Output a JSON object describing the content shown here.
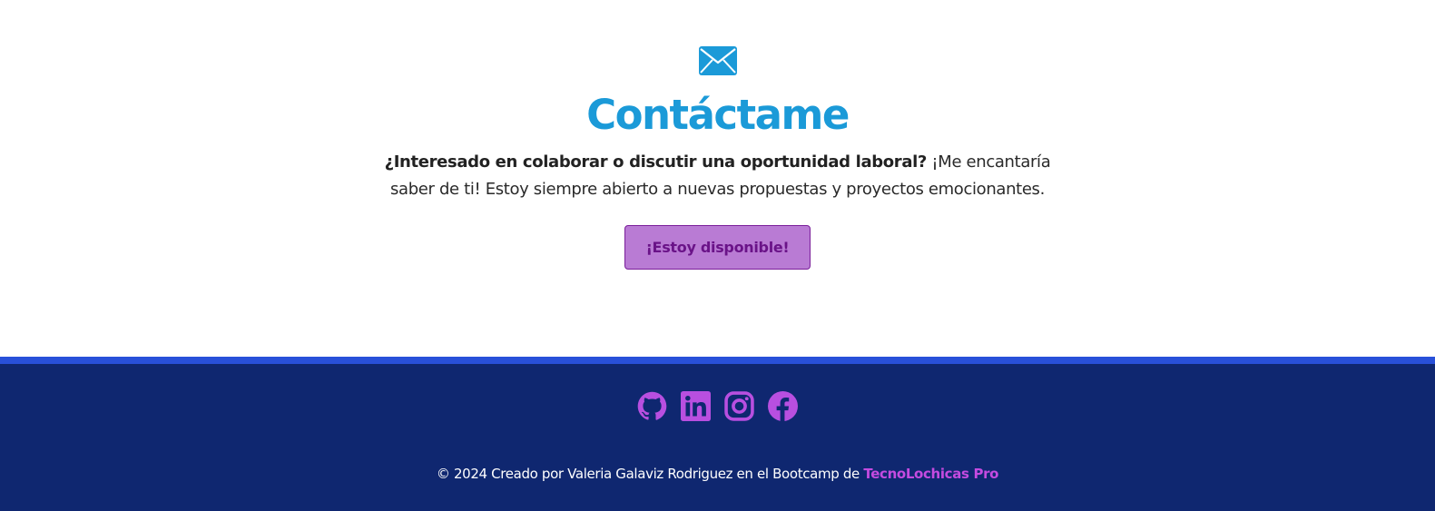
{
  "contact": {
    "icon": "envelope-icon",
    "title": "Contáctame",
    "lead_bold": "¿Interesado en colaborar o discutir una oportunidad laboral?",
    "lead_text": " ¡Me encantaría saber de ti! Estoy siempre abierto a nuevas propuestas y proyectos emocionantes.",
    "button_label": "¡Estoy disponible!"
  },
  "footer": {
    "social_icons": [
      "github-icon",
      "linkedin-icon",
      "instagram-icon",
      "facebook-icon"
    ],
    "copyright_text": "© 2024 Creado por Valeria Galaviz Rodriguez en el Bootcamp de ",
    "brand_link": "TecnoLochicas Pro"
  },
  "colors": {
    "accent_blue": "#1b9ad8",
    "button_bg": "#b97bd4",
    "button_text": "#6a1388",
    "footer_bg": "#0f2770",
    "footer_stripe": "#2850d9",
    "social_icon": "#b84fe0",
    "brand_link": "#c44be0"
  }
}
